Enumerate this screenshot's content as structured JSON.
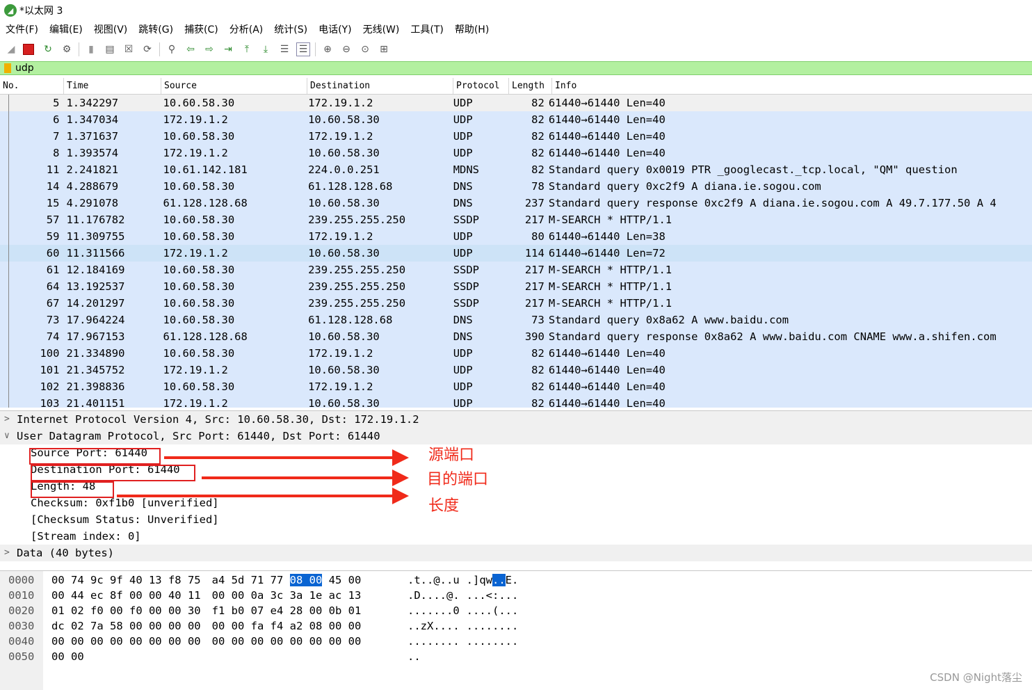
{
  "window": {
    "title": "*以太网 3"
  },
  "menu": [
    "文件(F)",
    "编辑(E)",
    "视图(V)",
    "跳转(G)",
    "捕获(C)",
    "分析(A)",
    "统计(S)",
    "电话(Y)",
    "无线(W)",
    "工具(T)",
    "帮助(H)"
  ],
  "filter": {
    "value": "udp"
  },
  "packet_list": {
    "columns": [
      "No.",
      "Time",
      "Source",
      "Destination",
      "Protocol",
      "Length",
      "Info"
    ],
    "rows": [
      {
        "no": "5",
        "time": "1.342297",
        "src": "10.60.58.30",
        "dst": "172.19.1.2",
        "proto": "UDP",
        "len": "82",
        "info": "61440→61440 Len=40"
      },
      {
        "no": "6",
        "time": "1.347034",
        "src": "172.19.1.2",
        "dst": "10.60.58.30",
        "proto": "UDP",
        "len": "82",
        "info": "61440→61440 Len=40"
      },
      {
        "no": "7",
        "time": "1.371637",
        "src": "10.60.58.30",
        "dst": "172.19.1.2",
        "proto": "UDP",
        "len": "82",
        "info": "61440→61440 Len=40"
      },
      {
        "no": "8",
        "time": "1.393574",
        "src": "172.19.1.2",
        "dst": "10.60.58.30",
        "proto": "UDP",
        "len": "82",
        "info": "61440→61440 Len=40"
      },
      {
        "no": "11",
        "time": "2.241821",
        "src": "10.61.142.181",
        "dst": "224.0.0.251",
        "proto": "MDNS",
        "len": "82",
        "info": "Standard query 0x0019 PTR _googlecast._tcp.local, \"QM\" question"
      },
      {
        "no": "14",
        "time": "4.288679",
        "src": "10.60.58.30",
        "dst": "61.128.128.68",
        "proto": "DNS",
        "len": "78",
        "info": "Standard query 0xc2f9 A diana.ie.sogou.com"
      },
      {
        "no": "15",
        "time": "4.291078",
        "src": "61.128.128.68",
        "dst": "10.60.58.30",
        "proto": "DNS",
        "len": "237",
        "info": "Standard query response 0xc2f9 A diana.ie.sogou.com A 49.7.177.50 A 4"
      },
      {
        "no": "57",
        "time": "11.176782",
        "src": "10.60.58.30",
        "dst": "239.255.255.250",
        "proto": "SSDP",
        "len": "217",
        "info": "M-SEARCH * HTTP/1.1"
      },
      {
        "no": "59",
        "time": "11.309755",
        "src": "10.60.58.30",
        "dst": "172.19.1.2",
        "proto": "UDP",
        "len": "80",
        "info": "61440→61440 Len=38"
      },
      {
        "no": "60",
        "time": "11.311566",
        "src": "172.19.1.2",
        "dst": "10.60.58.30",
        "proto": "UDP",
        "len": "114",
        "info": "61440→61440 Len=72"
      },
      {
        "no": "61",
        "time": "12.184169",
        "src": "10.60.58.30",
        "dst": "239.255.255.250",
        "proto": "SSDP",
        "len": "217",
        "info": "M-SEARCH * HTTP/1.1"
      },
      {
        "no": "64",
        "time": "13.192537",
        "src": "10.60.58.30",
        "dst": "239.255.255.250",
        "proto": "SSDP",
        "len": "217",
        "info": "M-SEARCH * HTTP/1.1"
      },
      {
        "no": "67",
        "time": "14.201297",
        "src": "10.60.58.30",
        "dst": "239.255.255.250",
        "proto": "SSDP",
        "len": "217",
        "info": "M-SEARCH * HTTP/1.1"
      },
      {
        "no": "73",
        "time": "17.964224",
        "src": "10.60.58.30",
        "dst": "61.128.128.68",
        "proto": "DNS",
        "len": "73",
        "info": "Standard query 0x8a62 A www.baidu.com"
      },
      {
        "no": "74",
        "time": "17.967153",
        "src": "61.128.128.68",
        "dst": "10.60.58.30",
        "proto": "DNS",
        "len": "390",
        "info": "Standard query response 0x8a62 A www.baidu.com CNAME www.a.shifen.com"
      },
      {
        "no": "100",
        "time": "21.334890",
        "src": "10.60.58.30",
        "dst": "172.19.1.2",
        "proto": "UDP",
        "len": "82",
        "info": "61440→61440 Len=40"
      },
      {
        "no": "101",
        "time": "21.345752",
        "src": "172.19.1.2",
        "dst": "10.60.58.30",
        "proto": "UDP",
        "len": "82",
        "info": "61440→61440 Len=40"
      },
      {
        "no": "102",
        "time": "21.398836",
        "src": "10.60.58.30",
        "dst": "172.19.1.2",
        "proto": "UDP",
        "len": "82",
        "info": "61440→61440 Len=40"
      },
      {
        "no": "103",
        "time": "21.401151",
        "src": "172.19.1.2",
        "dst": "10.60.58.30",
        "proto": "UDP",
        "len": "82",
        "info": "61440→61440 Len=40"
      }
    ]
  },
  "details": {
    "ip": "Internet Protocol Version 4, Src: 10.60.58.30, Dst: 172.19.1.2",
    "udp": "User Datagram Protocol, Src Port: 61440, Dst Port: 61440",
    "src_port": "Source Port: 61440",
    "dst_port": "Destination Port: 61440",
    "length": "Length: 48",
    "checksum": "Checksum: 0xf1b0 [unverified]",
    "checksum_status": "[Checksum Status: Unverified]",
    "stream_index": "[Stream index: 0]",
    "data": "Data (40 bytes)"
  },
  "annotations": {
    "src_port": "源端口",
    "dst_port": "目的端口",
    "length": "长度"
  },
  "bytes": [
    {
      "off": "0000",
      "hex_a": "00 74 9c 9f 40 13 f8 75",
      "hex_b1": "a4 5d 71 77 ",
      "hex_sel": "08 00",
      "hex_b2": " 45 00",
      "asc_a": ".t..@..u",
      "asc_b1": ".]qw",
      "asc_sel": "..",
      "asc_b2": "E."
    },
    {
      "off": "0010",
      "hex_a": "00 44 ec 8f 00 00 40 11",
      "hex_b1": "00 00 0a 3c 3a 1e ac 13",
      "hex_sel": "",
      "hex_b2": "",
      "asc_a": ".D....@.",
      "asc_b1": "...<:...",
      "asc_sel": "",
      "asc_b2": ""
    },
    {
      "off": "0020",
      "hex_a": "01 02 f0 00 f0 00 00 30",
      "hex_b1": "f1 b0 07 e4 28 00 0b 01",
      "hex_sel": "",
      "hex_b2": "",
      "asc_a": ".......0",
      "asc_b1": "....(...",
      "asc_sel": "",
      "asc_b2": ""
    },
    {
      "off": "0030",
      "hex_a": "dc 02 7a 58 00 00 00 00",
      "hex_b1": "00 00 fa f4 a2 08 00 00",
      "hex_sel": "",
      "hex_b2": "",
      "asc_a": "..zX....",
      "asc_b1": "........",
      "asc_sel": "",
      "asc_b2": ""
    },
    {
      "off": "0040",
      "hex_a": "00 00 00 00 00 00 00 00",
      "hex_b1": "00 00 00 00 00 00 00 00",
      "hex_sel": "",
      "hex_b2": "",
      "asc_a": "........",
      "asc_b1": "........",
      "asc_sel": "",
      "asc_b2": ""
    },
    {
      "off": "0050",
      "hex_a": "00 00",
      "hex_b1": "",
      "hex_sel": "",
      "hex_b2": "",
      "asc_a": "..",
      "asc_b1": "",
      "asc_sel": "",
      "asc_b2": ""
    }
  ],
  "watermark": "CSDN @Night落尘",
  "colors": {
    "row_bg": "#dae8fc",
    "filter_bg": "#b3f0a0",
    "annotation": "#f02a1a",
    "selection": "#0a64d2"
  }
}
